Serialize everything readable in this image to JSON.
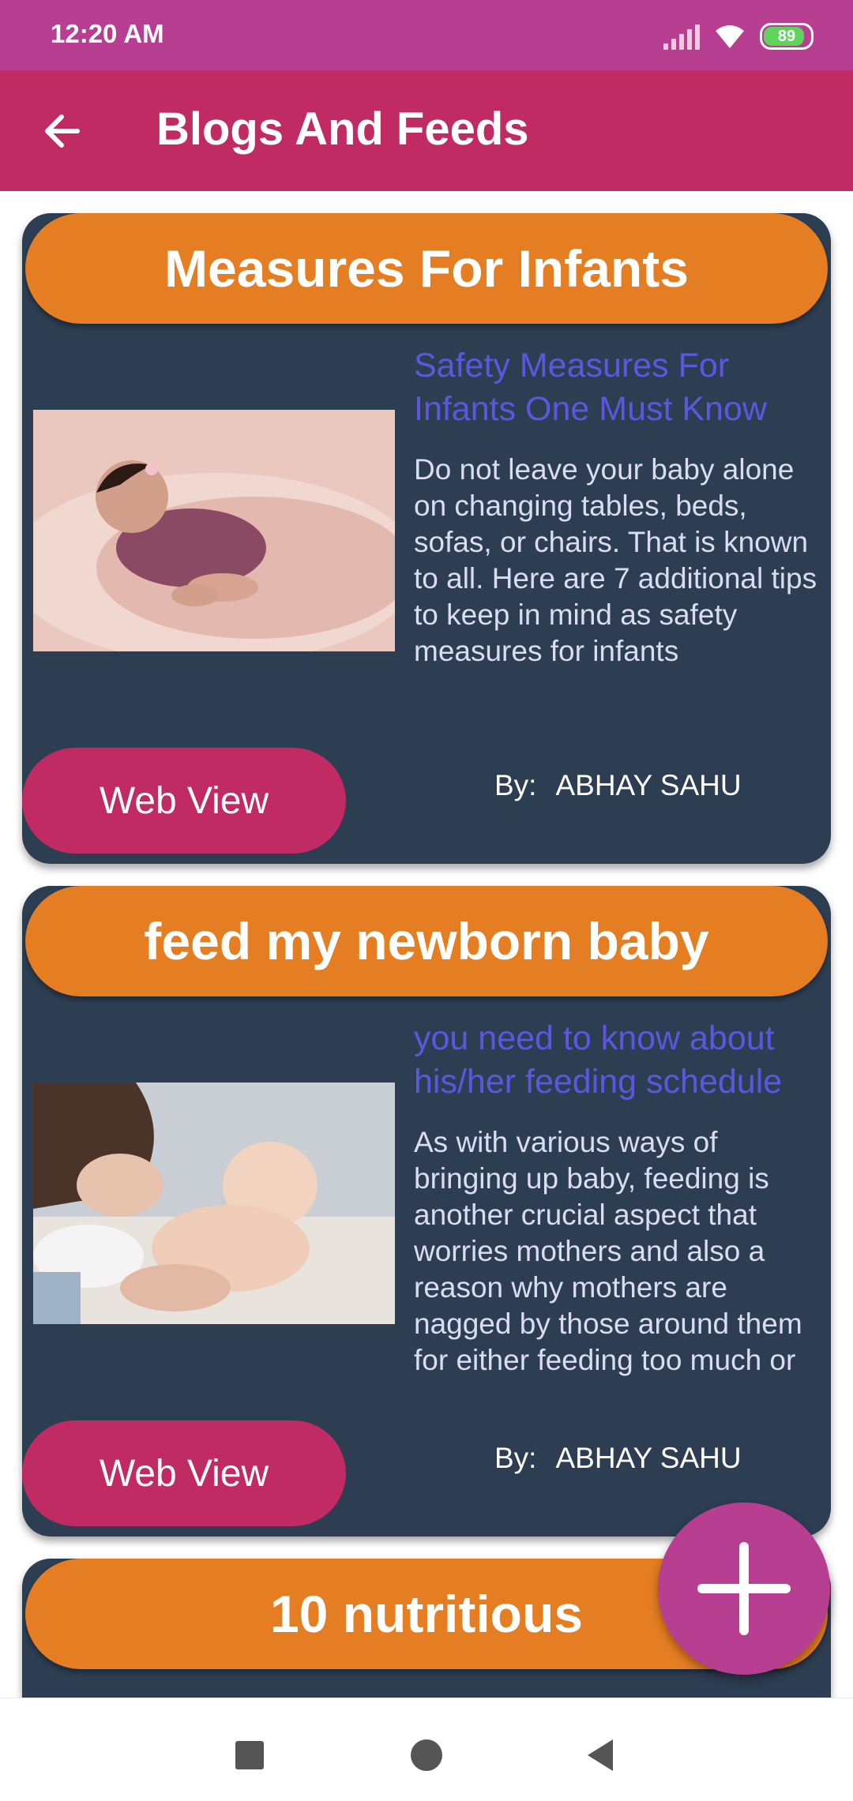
{
  "status_bar": {
    "time": "12:20 AM",
    "battery": "89"
  },
  "app_bar": {
    "title": "Blogs And Feeds"
  },
  "cards": [
    {
      "title": "Measures For Infants",
      "subtitle": "Safety Measures For Infants One Must Know",
      "body": "Do not leave your baby alone on changing tables, beds, sofas, or chairs. That is known to all. Here are 7 additional tips to keep in mind as safety measures for infants",
      "button_label": "Web View",
      "by_label": "By:",
      "author": "ABHAY SAHU"
    },
    {
      "title": "feed my newborn baby",
      "subtitle": "you need to know about his/her feeding schedule",
      "body": "As with various ways of bringing up baby, feeding is another crucial aspect that worries mothers and also a reason why mothers are nagged by those around them for either feeding too much or not feeding",
      "button_label": "Web View",
      "by_label": "By:",
      "author": "ABHAY SAHU"
    },
    {
      "title": "10 nutritious"
    }
  ],
  "colors": {
    "status_bar": "#b73e91",
    "app_bar": "#c02b63",
    "card_bg": "#2d3d52",
    "card_header": "#e57e22",
    "button": "#c02b63",
    "subtitle": "#5d57e0",
    "fab": "#b73e91"
  },
  "icons": {
    "back": "arrow-left-icon",
    "fab": "plus-icon",
    "nav": [
      "square-recents-icon",
      "circle-home-icon",
      "triangle-back-icon"
    ]
  }
}
